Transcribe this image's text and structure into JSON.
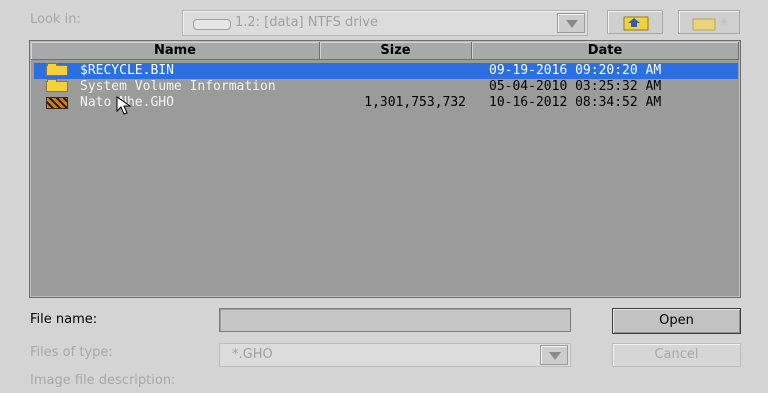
{
  "look_in": {
    "label": "Look in:",
    "value": "1.2: [data] NTFS drive",
    "icons": [
      "drive-icon",
      "chevron-down-icon",
      "up-one-level-icon",
      "new-folder-icon"
    ]
  },
  "columns": [
    "Name",
    "Size",
    "Date"
  ],
  "files": [
    {
      "name": "$RECYCLE.BIN",
      "size": "",
      "date": "09-19-2016 09:20:20 AM",
      "icon": "folder-icon",
      "selected": true
    },
    {
      "name": "System Volume Information",
      "size": "",
      "date": "05-04-2010 03:25:32 AM",
      "icon": "folder-icon",
      "selected": false
    },
    {
      "name": "Nato  Nhe.GHO",
      "size": "1,301,753,732",
      "date": "10-16-2012 08:34:52 AM",
      "icon": "ghost-image-icon",
      "selected": false
    }
  ],
  "file_name": {
    "label": "File name:",
    "value": ""
  },
  "files_of_type": {
    "label": "Files of type:",
    "value": "*.GHO"
  },
  "image_description": {
    "label": "Image file description:"
  },
  "buttons": {
    "open": "Open",
    "cancel": "Cancel"
  },
  "colors": {
    "selection": "#2b6fe0",
    "list_bg": "#9b9b9b",
    "dialog_bg": "#d4d4d4"
  }
}
